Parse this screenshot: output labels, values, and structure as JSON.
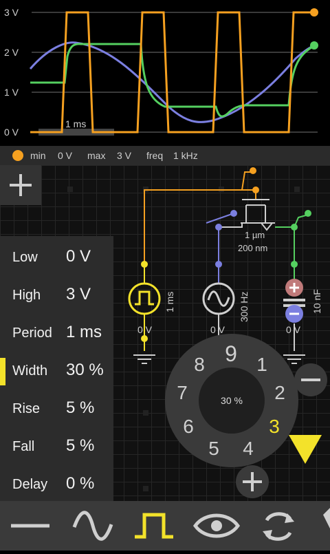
{
  "scope": {
    "y_labels": [
      "3 V",
      "2 V",
      "1 V",
      "0 V"
    ],
    "time_scale": "1 ms",
    "colors": {
      "square": "#f5a020",
      "sine": "#7b7fe0",
      "capacitor": "#55d060",
      "grid": "#3a3a3a"
    }
  },
  "chart_data": {
    "type": "line",
    "yticks": [
      "0 V",
      "1 V",
      "2 V",
      "3 V"
    ],
    "ylim": [
      0,
      3
    ],
    "time_scale": "1 ms",
    "series": [
      {
        "color": "#f5a020",
        "shape": "square",
        "min": 0,
        "max": 3
      },
      {
        "color": "#7b7fe0",
        "shape": "sine"
      },
      {
        "color": "#55d060",
        "shape": "rc-response"
      }
    ]
  },
  "infobar": {
    "min_label": "min",
    "min_value": "0 V",
    "max_label": "max",
    "max_value": "3 V",
    "freq_label": "freq",
    "freq_value": "1 kHz"
  },
  "circuit": {
    "pulse_value": "0 V",
    "pulse_period": "1 ms",
    "sine_value": "0 V",
    "sine_freq": "300 Hz",
    "cap_value": "0 V",
    "cap_size": "10 nF",
    "fet_w": "1 µm",
    "fet_l": "200 nm"
  },
  "params": [
    {
      "label": "Low",
      "value": "0 V",
      "selected": false
    },
    {
      "label": "High",
      "value": "3 V",
      "selected": false
    },
    {
      "label": "Period",
      "value": "1 ms",
      "selected": false
    },
    {
      "label": "Width",
      "value": "30 %",
      "selected": true
    },
    {
      "label": "Rise",
      "value": "5 %",
      "selected": false
    },
    {
      "label": "Fall",
      "value": "5 %",
      "selected": false
    },
    {
      "label": "Delay",
      "value": "0 %",
      "selected": false
    }
  ],
  "dial": {
    "center_value": "30 %",
    "digits": [
      "9",
      "1",
      "2",
      "3",
      "4",
      "5",
      "6",
      "7",
      "8"
    ],
    "active_digit": "3",
    "active_color": "#f3e22a"
  },
  "toolbar": {
    "items": [
      "wire-tool",
      "sine-tool",
      "pulse-tool",
      "view-tool",
      "swap-tool",
      "more-tool"
    ],
    "active": "pulse-tool"
  }
}
